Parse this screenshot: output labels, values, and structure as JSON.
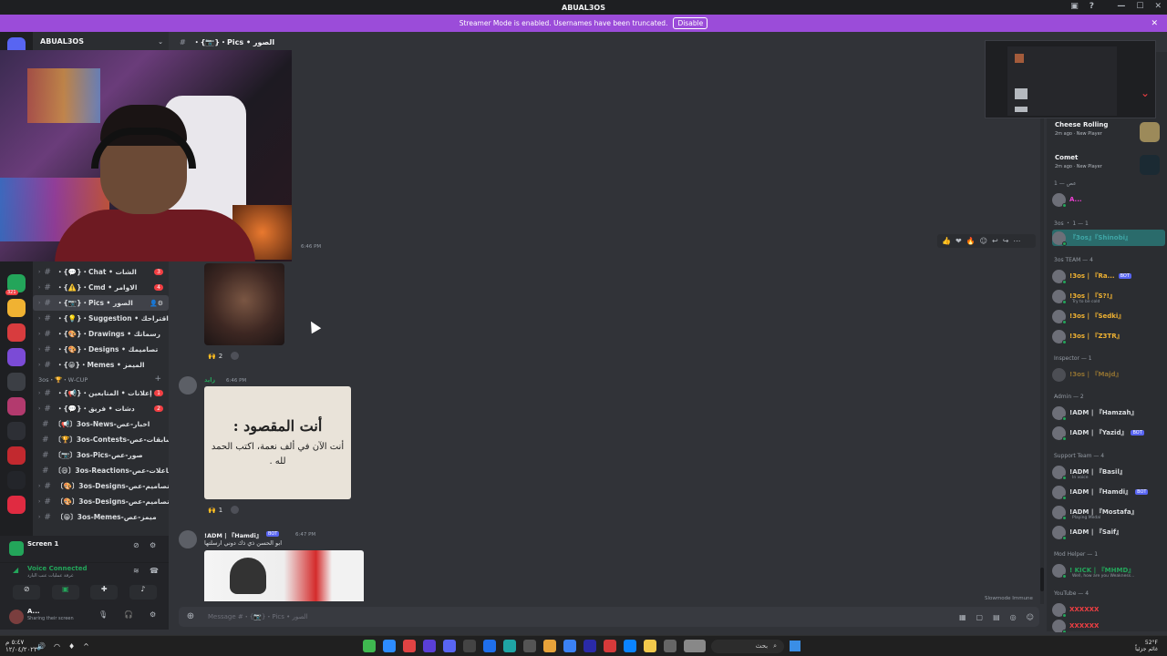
{
  "window": {
    "title": "ABUAL3OS"
  },
  "banner": {
    "text": "Streamer Mode is enabled. Usernames have been truncated.",
    "disable_label": "Disable"
  },
  "server": {
    "name": "ABUAL3OS"
  },
  "header": {
    "channel": "・{📷}・Pics • الصور"
  },
  "channels": [
    {
      "label": "・{💬}・Chat • الشات",
      "badge": "3",
      "kind": "text"
    },
    {
      "label": "・{⚠️}・Cmd • الاوامر",
      "badge": "4",
      "kind": "text"
    },
    {
      "label": "・{📷}・Pics • الصور",
      "badge": "",
      "kind": "text",
      "active": true
    },
    {
      "label": "・{💡}・Suggestion • اقتراحك",
      "badge": "",
      "kind": "text"
    },
    {
      "label": "・{🎨}・Drawings • رسماتك",
      "badge": "",
      "kind": "text"
    },
    {
      "label": "・{🎨}・Designs • تصاميمك",
      "badge": "",
      "kind": "text"
    },
    {
      "label": "・{😁}・Memes • الميمز",
      "badge": "",
      "kind": "text"
    }
  ],
  "category": {
    "label": "3os・🏆・W-CUP"
  },
  "channels2": [
    {
      "label": "・{📢}・إعلانات • المتابعين",
      "badge": "1"
    },
    {
      "label": "・{💬}・دشات • فريق",
      "badge": "2"
    },
    {
      "label": "〔📢〕3os-News-اخبار-عص",
      "badge": ""
    },
    {
      "label": "〔🏆〕3os-Contests-مسابقات-عص",
      "badge": ""
    },
    {
      "label": "〔📷〕3os-Pics-صور-عص",
      "badge": ""
    },
    {
      "label": "〔😄〕3os-Reactions-تفاعلات-عص",
      "badge": ""
    },
    {
      "label": "〔🎨〕3os-Designs-تصاميم-عص",
      "badge": ""
    },
    {
      "label": "〔🎨〕3os-Designs-تصاميم-عص",
      "badge": ""
    },
    {
      "label": "〔😁〕3os-Memes-ميمز-عص",
      "badge": ""
    }
  ],
  "screen_panel": {
    "title": "Screen 1"
  },
  "voice_panel": {
    "status": "Voice Connected",
    "sub": "غرفة عمليات عنب البارد"
  },
  "user_panel": {
    "name": "A...",
    "status": "Sharing their screen"
  },
  "messages": [
    {
      "time": "6:46 PM",
      "reaction_emoji": "🙌",
      "reaction_count": "2"
    },
    {
      "author": "زايد",
      "time": "6:46 PM",
      "image_line1": "أنت المقصود :",
      "image_line2": "أنت الآن في ألف نعمة، اكتب الحمد لله .",
      "reaction_emoji": "🙌",
      "reaction_count": "1"
    },
    {
      "author": "!ADM | 『Hamdi』",
      "tag": "BOT",
      "time": "6:47 PM",
      "body": "ابو الحسن ذي ذك دوني ارسلتها"
    }
  ],
  "composer": {
    "placeholder": "Message #・{📷}・Pics • الصور",
    "slowmode": "Slowmode Immune"
  },
  "members": {
    "activities": [
      {
        "title": "Cheese Rolling",
        "sub": "2m ago · New Player",
        "color": "#9c8a5a"
      },
      {
        "title": "Comet",
        "sub": "2m ago · New Player",
        "color": "#1b2a33"
      }
    ],
    "groups": [
      {
        "label": "عص — 1",
        "members": [
          {
            "name": "A...",
            "color": "#f23fd6"
          }
        ]
      },
      {
        "label": "3os ・ 1 — 1",
        "members": [
          {
            "name": "『3os』『Shinobi』",
            "color": "#2a8a8a"
          }
        ]
      },
      {
        "label": "3os TEAM — 4",
        "members": [
          {
            "name": "!3os | 『Ra...",
            "color": "#f0b232",
            "tag": "BOT"
          },
          {
            "name": "!3os | 『S?!』",
            "color": "#f0b232",
            "sub": "Try to be cold"
          },
          {
            "name": "!3os | 『Sedki』",
            "color": "#f0b232"
          },
          {
            "name": "!3os | 『Z3TR』",
            "color": "#f0b232"
          }
        ]
      },
      {
        "label": "Inspector — 1",
        "members": [
          {
            "name": "!3os | 『Majd』",
            "color": "#f0b232"
          }
        ]
      },
      {
        "label": "Admin — 2",
        "members": [
          {
            "name": "!ADM | 『Hamzah』",
            "color": "#dbdee1"
          },
          {
            "name": "!ADM | 『Yazid』",
            "color": "#dbdee1",
            "tag": "BOT"
          }
        ]
      },
      {
        "label": "Support Team — 4",
        "members": [
          {
            "name": "!ADM | 『Basil』",
            "color": "#dbdee1",
            "sub": "In voice"
          },
          {
            "name": "!ADM | 『Hamdi』",
            "color": "#dbdee1",
            "tag": "BOT"
          },
          {
            "name": "!ADM | 『Mostafa』",
            "color": "#dbdee1",
            "sub": "Playing Medal"
          },
          {
            "name": "!ADM | 『Saif』",
            "color": "#dbdee1"
          }
        ]
      },
      {
        "label": "Mod Helper — 1",
        "members": [
          {
            "name": "! KICK | 『MHMD』",
            "color": "#23a55a",
            "sub": "Well, how are you Weakness..."
          }
        ]
      },
      {
        "label": "YouTube — 4",
        "members": [
          {
            "name": "XXXXXX",
            "color": "#f23f43"
          },
          {
            "name": "XXXXXX",
            "color": "#f23f43"
          }
        ]
      }
    ]
  },
  "taskbar": {
    "time": "٥:٤٧ م",
    "date": "١٢/٠٤/٢٠٢٣",
    "search_label": "بحث",
    "temp": "52°F",
    "weather": "غائم جزئياً"
  },
  "colors": {
    "accent": "#9b4cd9",
    "bg": "#313338",
    "sidebar": "#2b2d31",
    "rail": "#1e1f22"
  }
}
